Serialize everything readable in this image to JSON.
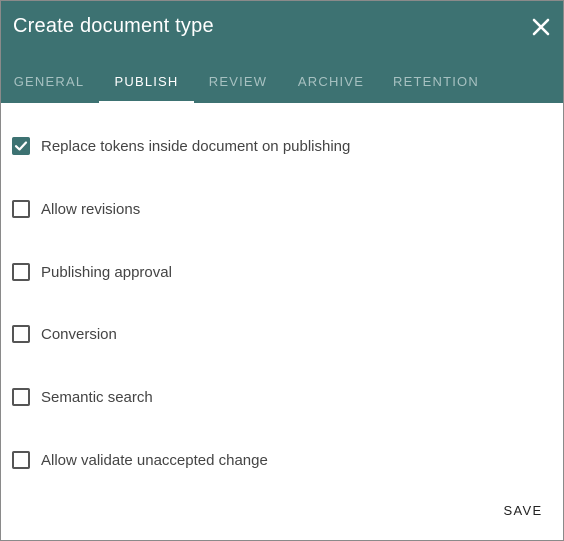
{
  "dialog": {
    "title": "Create document type",
    "close_icon": "close-icon"
  },
  "colors": {
    "header_bg": "#3d7272",
    "tab_inactive": "#a7c1c1",
    "tab_active": "#ffffff",
    "checkbox_checked": "#3d7272"
  },
  "tabs": [
    {
      "label": "GENERAL",
      "active": false
    },
    {
      "label": "PUBLISH",
      "active": true
    },
    {
      "label": "REVIEW",
      "active": false
    },
    {
      "label": "ARCHIVE",
      "active": false
    },
    {
      "label": "RETENTION",
      "active": false
    }
  ],
  "options": [
    {
      "label": "Replace tokens inside document on publishing",
      "checked": true
    },
    {
      "label": "Allow revisions",
      "checked": false
    },
    {
      "label": "Publishing approval",
      "checked": false
    },
    {
      "label": "Conversion",
      "checked": false
    },
    {
      "label": "Semantic search",
      "checked": false
    },
    {
      "label": "Allow validate unaccepted change",
      "checked": false
    }
  ],
  "footer": {
    "save_label": "SAVE"
  }
}
